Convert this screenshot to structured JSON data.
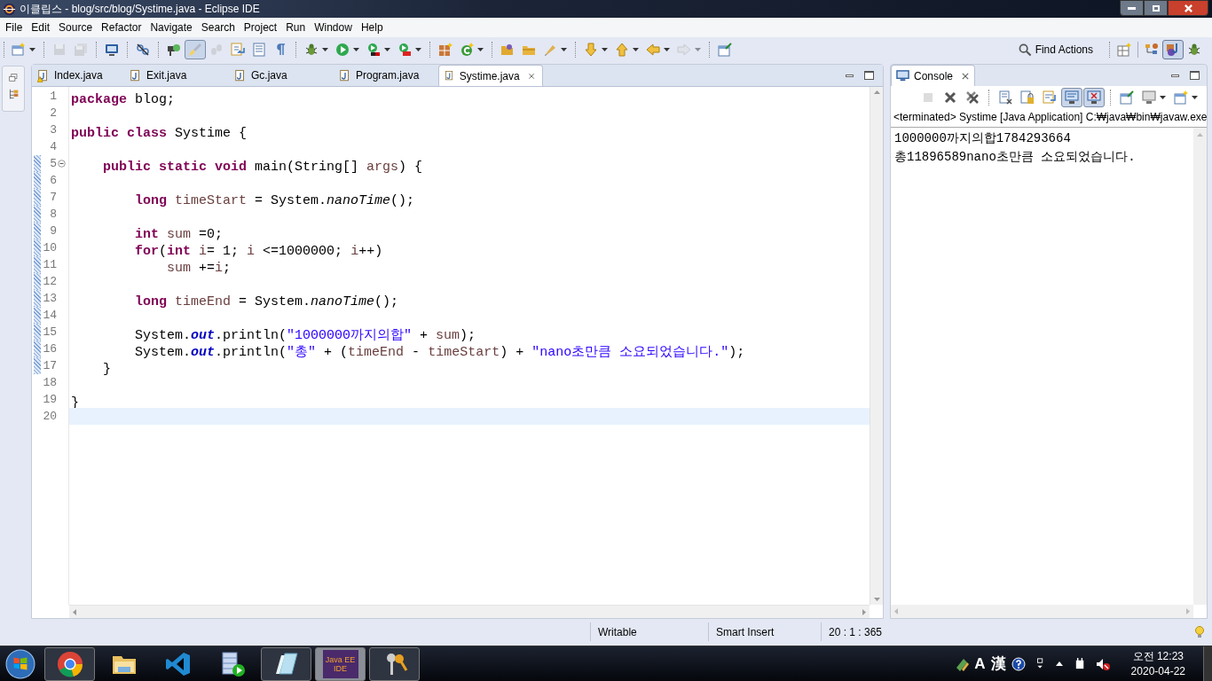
{
  "window": {
    "title": "이클립스 - blog/src/blog/Systime.java - Eclipse IDE"
  },
  "menu": [
    "File",
    "Edit",
    "Source",
    "Refactor",
    "Navigate",
    "Search",
    "Project",
    "Run",
    "Window",
    "Help"
  ],
  "toolbar": [
    {
      "kind": "new",
      "dropdown": true,
      "disabled": false,
      "pressed": false
    },
    {
      "kind": "separator"
    },
    {
      "kind": "save",
      "dropdown": false,
      "disabled": true,
      "pressed": false
    },
    {
      "kind": "saveall",
      "dropdown": false,
      "disabled": true,
      "pressed": false
    },
    {
      "kind": "separator"
    },
    {
      "kind": "terminal",
      "dropdown": false,
      "disabled": false,
      "pressed": false
    },
    {
      "kind": "separator"
    },
    {
      "kind": "unlink",
      "dropdown": false,
      "disabled": false,
      "pressed": false
    },
    {
      "kind": "separator"
    },
    {
      "kind": "annotation",
      "dropdown": false,
      "disabled": false,
      "pressed": false
    },
    {
      "kind": "brush",
      "dropdown": false,
      "disabled": false,
      "pressed": true
    },
    {
      "kind": "steps",
      "dropdown": false,
      "disabled": true,
      "pressed": false
    },
    {
      "kind": "docarrow",
      "dropdown": false,
      "disabled": false,
      "pressed": false
    },
    {
      "kind": "docblock",
      "dropdown": false,
      "disabled": false,
      "pressed": false
    },
    {
      "kind": "pilcrow",
      "dropdown": false,
      "disabled": false,
      "pressed": false
    },
    {
      "kind": "separator"
    },
    {
      "kind": "debug",
      "dropdown": true,
      "disabled": false,
      "pressed": false
    },
    {
      "kind": "run",
      "dropdown": true,
      "disabled": false,
      "pressed": false
    },
    {
      "kind": "coverage",
      "dropdown": true,
      "disabled": false,
      "pressed": false
    },
    {
      "kind": "external",
      "dropdown": true,
      "disabled": false,
      "pressed": false
    },
    {
      "kind": "separator"
    },
    {
      "kind": "package",
      "dropdown": false,
      "disabled": false,
      "pressed": false
    },
    {
      "kind": "create",
      "dropdown": true,
      "disabled": false,
      "pressed": false
    },
    {
      "kind": "separator"
    },
    {
      "kind": "folderopen",
      "dropdown": false,
      "disabled": false,
      "pressed": false
    },
    {
      "kind": "folder",
      "dropdown": false,
      "disabled": false,
      "pressed": false
    },
    {
      "kind": "pen",
      "dropdown": true,
      "disabled": false,
      "pressed": false
    },
    {
      "kind": "separator"
    },
    {
      "kind": "down",
      "dropdown": true,
      "disabled": false,
      "pressed": false
    },
    {
      "kind": "up",
      "dropdown": true,
      "disabled": false,
      "pressed": false
    },
    {
      "kind": "back",
      "dropdown": true,
      "disabled": false,
      "pressed": false
    },
    {
      "kind": "forward",
      "dropdown": true,
      "disabled": true,
      "pressed": false
    },
    {
      "kind": "separator"
    },
    {
      "kind": "pin",
      "dropdown": false,
      "disabled": false,
      "pressed": false
    }
  ],
  "find_actions": {
    "label": "Find Actions"
  },
  "perspectives": [
    {
      "kind": "open",
      "selected": false
    },
    {
      "kind": "javaee",
      "selected": false
    },
    {
      "kind": "java",
      "selected": true
    },
    {
      "kind": "debug",
      "selected": false
    }
  ],
  "editor": {
    "tabs": [
      {
        "label": "Index.java",
        "selected": false,
        "warning": true
      },
      {
        "label": "Exit.java",
        "selected": false,
        "warning": false
      },
      {
        "label": "Gc.java",
        "selected": false,
        "warning": false
      },
      {
        "label": "Program.java",
        "selected": false,
        "warning": false
      },
      {
        "label": "Systime.java",
        "selected": true,
        "warning": false
      }
    ],
    "lines": [
      {
        "number": "1",
        "changed": false,
        "tokens": [
          {
            "kind": "kw",
            "text": "package "
          },
          {
            "kind": "text",
            "text": "blog;"
          }
        ]
      },
      {
        "number": "2",
        "changed": false
      },
      {
        "number": "3",
        "changed": false,
        "tokens": [
          {
            "kind": "kw",
            "text": "public class "
          },
          {
            "kind": "text",
            "text": "Systime {"
          }
        ]
      },
      {
        "number": "4",
        "changed": false
      },
      {
        "number": "5",
        "changed": true,
        "foldable": true,
        "tokens": [
          {
            "kind": "kw",
            "text": "    public static void "
          },
          {
            "kind": "text",
            "text": "main(String[] "
          },
          {
            "kind": "var",
            "text": "args"
          },
          {
            "kind": "text",
            "text": ") {"
          }
        ]
      },
      {
        "number": "6",
        "changed": true
      },
      {
        "number": "7",
        "changed": true,
        "tokens": [
          {
            "kind": "kw",
            "text": "        long "
          },
          {
            "kind": "var",
            "text": "timeStart"
          },
          {
            "kind": "text",
            "text": " = System."
          },
          {
            "kind": "static",
            "text": "nanoTime"
          },
          {
            "kind": "text",
            "text": "();"
          }
        ]
      },
      {
        "number": "8",
        "changed": true
      },
      {
        "number": "9",
        "changed": true,
        "tokens": [
          {
            "kind": "kw",
            "text": "        int "
          },
          {
            "kind": "var",
            "text": "sum"
          },
          {
            "kind": "text",
            "text": " =0;"
          }
        ]
      },
      {
        "number": "10",
        "changed": true,
        "tokens": [
          {
            "kind": "kw",
            "text": "        for"
          },
          {
            "kind": "text",
            "text": "("
          },
          {
            "kind": "kw",
            "text": "int "
          },
          {
            "kind": "var",
            "text": "i"
          },
          {
            "kind": "text",
            "text": "= 1; "
          },
          {
            "kind": "var",
            "text": "i"
          },
          {
            "kind": "text",
            "text": " <=1000000; "
          },
          {
            "kind": "var",
            "text": "i"
          },
          {
            "kind": "text",
            "text": "++)"
          }
        ]
      },
      {
        "number": "11",
        "changed": true,
        "tokens": [
          {
            "kind": "var",
            "text": "            sum"
          },
          {
            "kind": "text",
            "text": " +="
          },
          {
            "kind": "var",
            "text": "i"
          },
          {
            "kind": "text",
            "text": ";"
          }
        ]
      },
      {
        "number": "12",
        "changed": true
      },
      {
        "number": "13",
        "changed": true,
        "tokens": [
          {
            "kind": "kw",
            "text": "        long "
          },
          {
            "kind": "var",
            "text": "timeEnd"
          },
          {
            "kind": "text",
            "text": " = System."
          },
          {
            "kind": "static",
            "text": "nanoTime"
          },
          {
            "kind": "text",
            "text": "();"
          }
        ]
      },
      {
        "number": "14",
        "changed": true
      },
      {
        "number": "15",
        "changed": true,
        "tokens": [
          {
            "kind": "text",
            "text": "        System."
          },
          {
            "kind": "field",
            "text": "out"
          },
          {
            "kind": "text",
            "text": ".println("
          },
          {
            "kind": "str",
            "text": "\"1000000까지의합\""
          },
          {
            "kind": "text",
            "text": " + "
          },
          {
            "kind": "var",
            "text": "sum"
          },
          {
            "kind": "text",
            "text": ");"
          }
        ]
      },
      {
        "number": "16",
        "changed": true,
        "tokens": [
          {
            "kind": "text",
            "text": "        System."
          },
          {
            "kind": "field",
            "text": "out"
          },
          {
            "kind": "text",
            "text": ".println("
          },
          {
            "kind": "str",
            "text": "\"총\""
          },
          {
            "kind": "text",
            "text": " + ("
          },
          {
            "kind": "var",
            "text": "timeEnd"
          },
          {
            "kind": "text",
            "text": " - "
          },
          {
            "kind": "var",
            "text": "timeStart"
          },
          {
            "kind": "text",
            "text": ") + "
          },
          {
            "kind": "str",
            "text": "\"nano초만큼 소요되었습니다.\""
          },
          {
            "kind": "text",
            "text": ");"
          }
        ]
      },
      {
        "number": "17",
        "changed": true,
        "tokens": [
          {
            "kind": "text",
            "text": "    }"
          }
        ]
      },
      {
        "number": "18",
        "changed": false
      },
      {
        "number": "19",
        "changed": false,
        "tokens": [
          {
            "kind": "text",
            "text": "}"
          }
        ]
      },
      {
        "number": "20",
        "changed": false,
        "current": true
      }
    ]
  },
  "console": {
    "tab": {
      "label": "Console",
      "selected": true
    },
    "toolbar": [
      {
        "kind": "stop",
        "dropdown": false,
        "disabled": true,
        "pressed": false
      },
      {
        "kind": "remove",
        "dropdown": false,
        "disabled": false,
        "pressed": false
      },
      {
        "kind": "removeall",
        "dropdown": false,
        "disabled": false,
        "pressed": false
      },
      {
        "kind": "separator"
      },
      {
        "kind": "clear",
        "dropdown": false,
        "disabled": false,
        "pressed": false
      },
      {
        "kind": "lock",
        "dropdown": false,
        "disabled": false,
        "pressed": false
      },
      {
        "kind": "wrap",
        "dropdown": false,
        "disabled": false,
        "pressed": false
      },
      {
        "kind": "stdout",
        "dropdown": false,
        "disabled": false,
        "pressed": true
      },
      {
        "kind": "stderr",
        "dropdown": false,
        "disabled": false,
        "pressed": true
      },
      {
        "kind": "separator"
      },
      {
        "kind": "pin",
        "dropdown": false,
        "disabled": false,
        "pressed": false
      },
      {
        "kind": "display",
        "dropdown": true,
        "disabled": false,
        "pressed": false
      },
      {
        "kind": "newconsole",
        "dropdown": true,
        "disabled": false,
        "pressed": false
      }
    ],
    "description": "<terminated> Systime [Java Application] C:₩java₩bin₩javaw.exe",
    "output": [
      "1000000까지의합1784293664",
      "총11896589nano초만큼 소요되었습니다."
    ]
  },
  "status_bar": [
    "Writable",
    "Smart Insert",
    "20 : 1 : 365"
  ],
  "taskbar": {
    "items": [
      {
        "kind": "chrome",
        "open": true,
        "selected": false
      },
      {
        "kind": "explorer",
        "open": false,
        "selected": false
      },
      {
        "kind": "vscode",
        "open": false,
        "selected": false
      },
      {
        "kind": "player",
        "open": false,
        "selected": false
      },
      {
        "kind": "notepad",
        "open": true,
        "selected": false
      },
      {
        "kind": "eclipse",
        "open": true,
        "selected": true,
        "label": [
          "Java EE",
          "IDE"
        ]
      },
      {
        "kind": "keys",
        "open": true,
        "selected": false
      }
    ],
    "tray": {
      "ime": [
        "A",
        "漢"
      ],
      "time": "오전 12:23",
      "date": "2020-04-22"
    }
  }
}
